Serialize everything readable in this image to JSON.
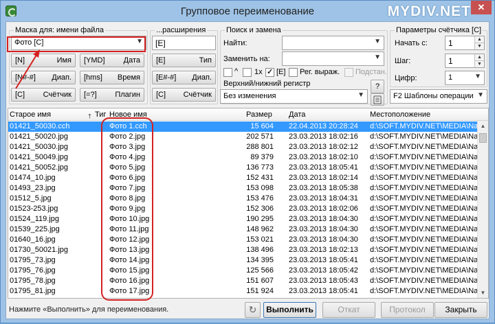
{
  "window": {
    "title": "Групповое переименование",
    "watermark": "MYDIV.NET",
    "close_glyph": "✕"
  },
  "mask": {
    "legend": "Маска для: имени файла",
    "value": "Фото [C]",
    "combo_arrow": "▼",
    "buttons": [
      {
        "code": "[N]",
        "label": "Имя"
      },
      {
        "code": "[YMD]",
        "label": "Дата"
      },
      {
        "code": "[N#-#]",
        "label": "Диап."
      },
      {
        "code": "[hms]",
        "label": "Время"
      },
      {
        "code": "[C]",
        "label": "Счётчик"
      },
      {
        "code": "[=?]",
        "label": "Плагин"
      }
    ]
  },
  "ext": {
    "legend": "...расширения",
    "value": "[E]",
    "buttons": [
      {
        "code": "[E]",
        "label": "Тип"
      },
      {
        "code": "[E#-#]",
        "label": "Диап."
      },
      {
        "code": "[C]",
        "label": "Счётчик"
      }
    ]
  },
  "search": {
    "legend": "Поиск и замена",
    "find_label": "Найти:",
    "replace_label": "Заменить на:",
    "find_value": "",
    "replace_value": "",
    "opt_case": "^",
    "opt_once": "1x",
    "opt_ext": "[E]",
    "opt_regex": "Рег. выраж.",
    "opt_subst": "Подстан.",
    "case_legend": "Верхний/нижний регистр",
    "case_value": "Без изменения",
    "help_label": "?"
  },
  "counter": {
    "legend": "Параметры счётчика [C]",
    "start_label": "Начать с:",
    "start_value": "1",
    "step_label": "Шаг:",
    "step_value": "1",
    "digits_label": "Цифр:",
    "digits_value": "1",
    "templates_label": "F2 Шаблоны операции"
  },
  "table": {
    "headers": [
      "Старое имя",
      "Тиг",
      "Новое имя",
      "Размер",
      "Дата",
      "Местоположение"
    ],
    "sort_arrow": "🡑",
    "rows": [
      {
        "old": "01421_50030.cch",
        "new": "Фото 1.cch",
        "size": "15 604",
        "date": "22.04.2013 20:28:24",
        "loc": "d:\\SOFT.MYDIV.NET\\MEDIA\\Nat("
      },
      {
        "old": "01421_50020.jpg",
        "new": "Фото 2.jpg",
        "size": "202 571",
        "date": "23.03.2013 18:02:16",
        "loc": "d:\\SOFT.MYDIV.NET\\MEDIA\\Nat("
      },
      {
        "old": "01421_50030.jpg",
        "new": "Фото 3.jpg",
        "size": "288 801",
        "date": "23.03.2013 18:02:12",
        "loc": "d:\\SOFT.MYDIV.NET\\MEDIA\\Nat("
      },
      {
        "old": "01421_50049.jpg",
        "new": "Фото 4.jpg",
        "size": "89 379",
        "date": "23.03.2013 18:02:10",
        "loc": "d:\\SOFT.MYDIV.NET\\MEDIA\\Nat("
      },
      {
        "old": "01421_50052.jpg",
        "new": "Фото 5.jpg",
        "size": "136 773",
        "date": "23.03.2013 18:05:41",
        "loc": "d:\\SOFT.MYDIV.NET\\MEDIA\\Nat("
      },
      {
        "old": "01474_10.jpg",
        "new": "Фото 6.jpg",
        "size": "152 431",
        "date": "23.03.2013 18:02:14",
        "loc": "d:\\SOFT.MYDIV.NET\\MEDIA\\Nat("
      },
      {
        "old": "01493_23.jpg",
        "new": "Фото 7.jpg",
        "size": "153 098",
        "date": "23.03.2013 18:05:38",
        "loc": "d:\\SOFT.MYDIV.NET\\MEDIA\\Nat("
      },
      {
        "old": "01512_5.jpg",
        "new": "Фото 8.jpg",
        "size": "153 476",
        "date": "23.03.2013 18:04:31",
        "loc": "d:\\SOFT.MYDIV.NET\\MEDIA\\Nat("
      },
      {
        "old": "01523-253.jpg",
        "new": "Фото 9.jpg",
        "size": "152 306",
        "date": "23.03.2013 18:02:06",
        "loc": "d:\\SOFT.MYDIV.NET\\MEDIA\\Nat("
      },
      {
        "old": "01524_119.jpg",
        "new": "Фото 10.jpg",
        "size": "190 295",
        "date": "23.03.2013 18:04:30",
        "loc": "d:\\SOFT.MYDIV.NET\\MEDIA\\Nat("
      },
      {
        "old": "01539_225.jpg",
        "new": "Фото 11.jpg",
        "size": "148 962",
        "date": "23.03.2013 18:04:30",
        "loc": "d:\\SOFT.MYDIV.NET\\MEDIA\\Nat("
      },
      {
        "old": "01640_16.jpg",
        "new": "Фото 12.jpg",
        "size": "153 021",
        "date": "23.03.2013 18:04:30",
        "loc": "d:\\SOFT.MYDIV.NET\\MEDIA\\Nat("
      },
      {
        "old": "01730_50021.jpg",
        "new": "Фото 13.jpg",
        "size": "138 496",
        "date": "23.03.2013 18:02:13",
        "loc": "d:\\SOFT.MYDIV.NET\\MEDIA\\Nat("
      },
      {
        "old": "01795_73.jpg",
        "new": "Фото 14.jpg",
        "size": "134 395",
        "date": "23.03.2013 18:05:41",
        "loc": "d:\\SOFT.MYDIV.NET\\MEDIA\\Nat("
      },
      {
        "old": "01795_76.jpg",
        "new": "Фото 15.jpg",
        "size": "125 566",
        "date": "23.03.2013 18:05:42",
        "loc": "d:\\SOFT.MYDIV.NET\\MEDIA\\Nat("
      },
      {
        "old": "01795_78.jpg",
        "new": "Фото 16.jpg",
        "size": "151 607",
        "date": "23.03.2013 18:05:43",
        "loc": "d:\\SOFT.MYDIV.NET\\MEDIA\\Nat("
      },
      {
        "old": "01795_81.jpg",
        "new": "Фото 17.jpg",
        "size": "151 924",
        "date": "23.03.2013 18:05:41",
        "loc": "d:\\SOFT.MYDIV.NET\\MEDIA\\Nat("
      }
    ]
  },
  "footer": {
    "status": "Нажмите «Выполнить» для переименования.",
    "refresh_glyph": "↻",
    "run": "Выполнить",
    "undo": "Откат",
    "log": "Протокол",
    "close": "Закрыть"
  },
  "colors": {
    "selection": "#3399ff",
    "annotation": "#d52020"
  }
}
